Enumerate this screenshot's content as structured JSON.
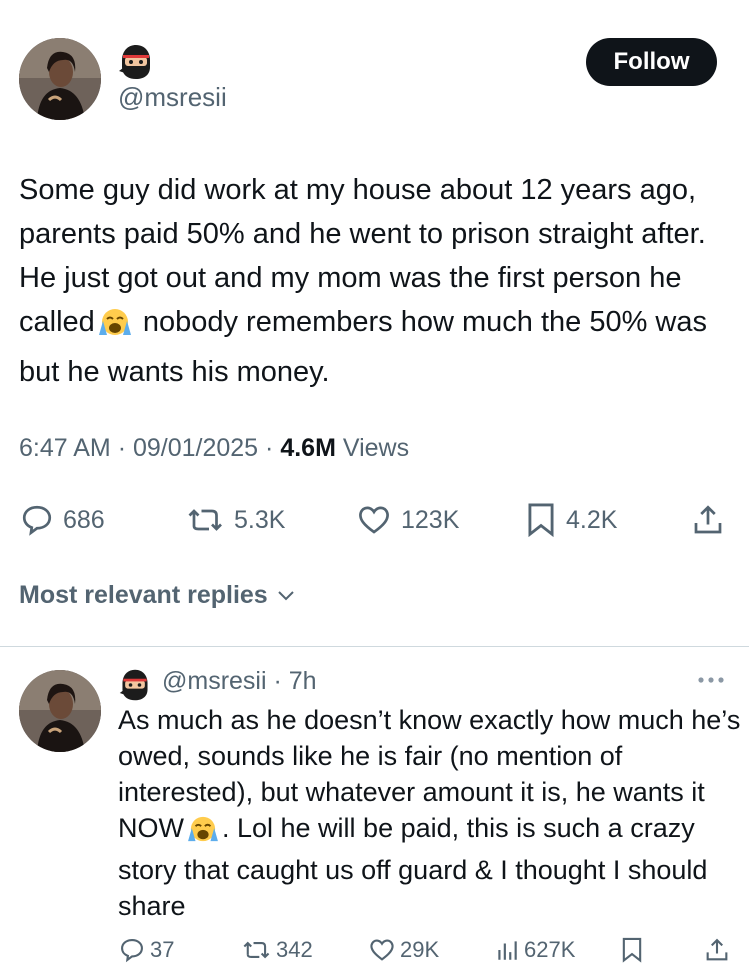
{
  "tweet": {
    "handle": "@msresii",
    "follow_label": "Follow",
    "text_before_emoji": "Some guy did work at my house about 12 years ago, parents paid 50% and he went to prison straight after. He just got out and my mom was the first person he called",
    "text_after_emoji": " nobody remembers how much the 50% was but he wants his money.",
    "time": "6:47 AM",
    "date": "09/01/2025",
    "views_count": "4.6M",
    "views_label": "Views",
    "replies": "686",
    "reposts": "5.3K",
    "likes": "123K",
    "bookmarks": "4.2K"
  },
  "replies_filter": {
    "label": "Most relevant replies"
  },
  "reply": {
    "handle": "@msresii",
    "age": "7h",
    "text_before_emoji": "As much as he doesn’t know exactly how much he’s owed, sounds like he is fair (no mention of interested), but whatever amount it is, he wants it NOW",
    "text_after_emoji": ". Lol he will be paid, this is such a crazy story that caught us off guard & I thought I should share",
    "replies": "37",
    "reposts": "342",
    "likes": "29K",
    "views": "627K"
  },
  "icons": {
    "ninja": "ninja-emoji-icon",
    "crying": "loudly-crying-face-emoji",
    "reply": "speech-bubble-icon",
    "repost": "repost-arrows-icon",
    "like": "heart-icon",
    "bookmark": "bookmark-icon",
    "share": "share-upload-icon",
    "views": "bar-chart-icon",
    "more": "three-dots-icon",
    "chevron": "chevron-down-icon"
  },
  "colors": {
    "text": "#0f1419",
    "secondary": "#536471",
    "follow_bg": "#0f1419",
    "divider": "#cfd9de"
  }
}
